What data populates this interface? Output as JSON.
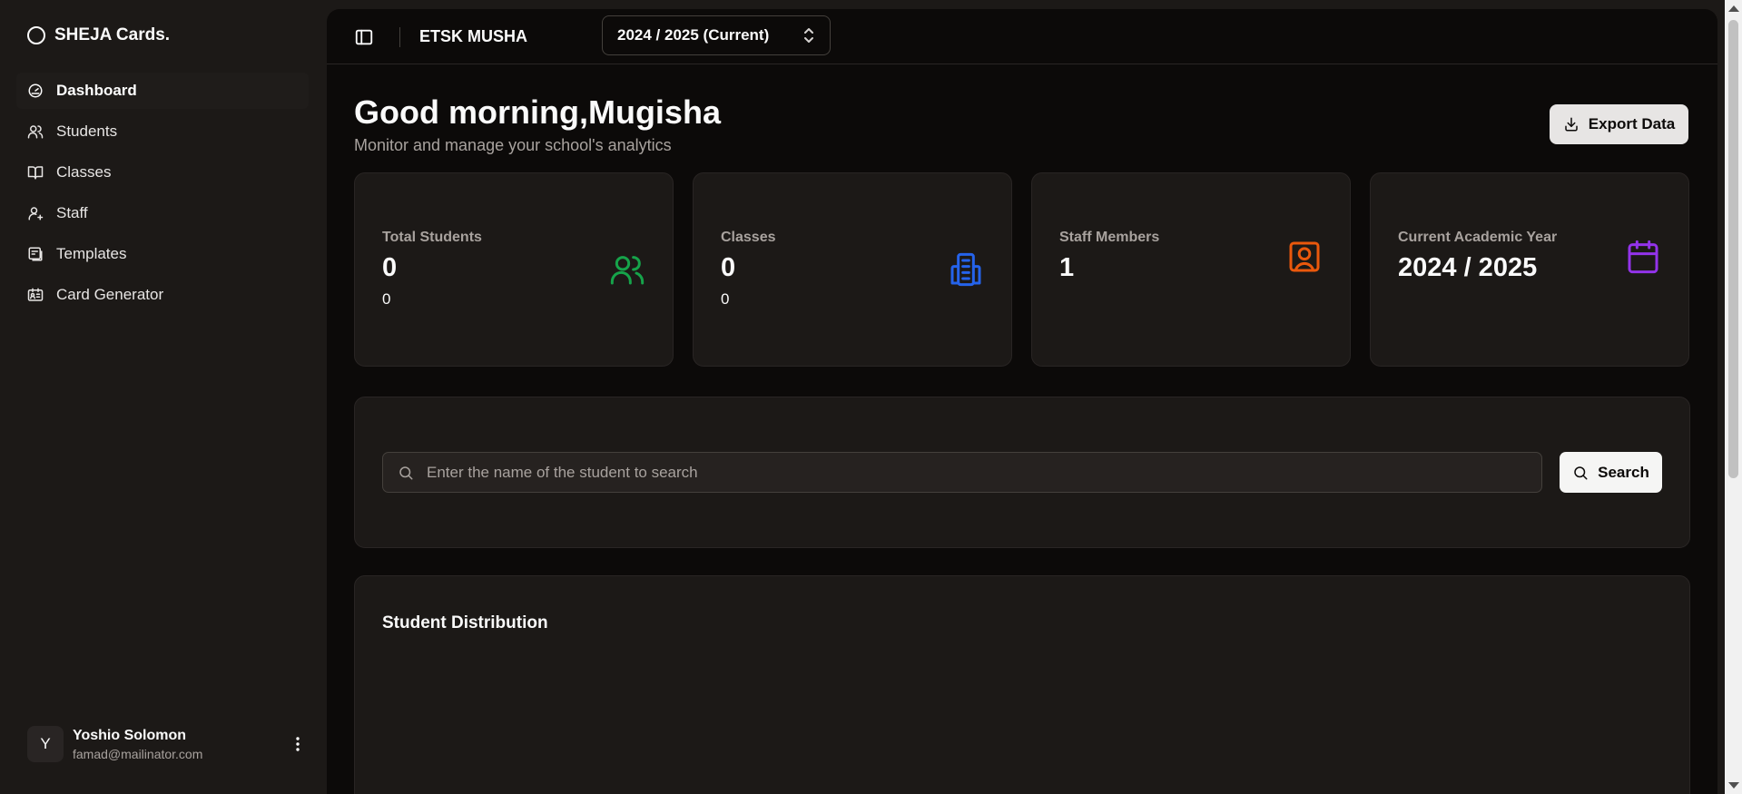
{
  "brand": {
    "name": "SHEJA Cards."
  },
  "sidebar": {
    "items": [
      {
        "label": "Dashboard",
        "icon": "gauge-icon",
        "active": true
      },
      {
        "label": "Students",
        "icon": "users-icon"
      },
      {
        "label": "Classes",
        "icon": "book-open-icon"
      },
      {
        "label": "Staff",
        "icon": "user-plus-icon"
      },
      {
        "label": "Templates",
        "icon": "templates-icon"
      },
      {
        "label": "Card Generator",
        "icon": "id-card-icon"
      }
    ]
  },
  "user": {
    "initial": "Y",
    "name": "Yoshio Solomon",
    "email": "famad@mailinator.com"
  },
  "header": {
    "school": "ETSK MUSHA",
    "year_select": "2024 / 2025 (Current)"
  },
  "page": {
    "greeting": "Good morning,Mugisha",
    "subtitle": "Monitor and manage your school's analytics",
    "export_label": "Export Data"
  },
  "stats": [
    {
      "label": "Total Students",
      "value": "0",
      "sub": "0",
      "icon": "users-icon",
      "color": "#16a34a"
    },
    {
      "label": "Classes",
      "value": "0",
      "sub": "0",
      "icon": "building-icon",
      "color": "#2563eb"
    },
    {
      "label": "Staff Members",
      "value": "1",
      "icon": "contact-icon",
      "color": "#ea580c"
    },
    {
      "label": "Current Academic Year",
      "value": "2024 / 2025",
      "icon": "calendar-icon",
      "color": "#9333ea"
    }
  ],
  "search": {
    "placeholder": "Enter the name of the student to search",
    "button_label": "Search"
  },
  "distribution": {
    "title": "Student Distribution"
  }
}
